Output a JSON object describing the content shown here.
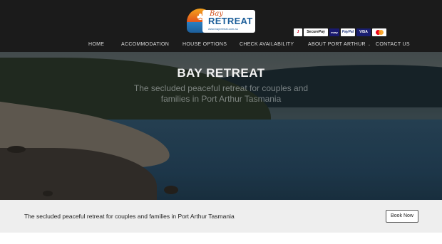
{
  "logo": {
    "small": "Bay",
    "big": "RETREAT",
    "url": "www.bayretreat.com.au",
    "icon": "tree-icon"
  },
  "payments": [
    {
      "label": "J",
      "icon": "payment-j-icon"
    },
    {
      "label": "SecurePay",
      "icon": "securepay-icon"
    },
    {
      "label": "eway",
      "icon": "payment-provider-icon"
    },
    {
      "label": "PayPal",
      "icon": "paypal-icon"
    },
    {
      "label": "VISA",
      "icon": "visa-icon"
    },
    {
      "label": "",
      "icon": "mastercard-icon"
    }
  ],
  "nav": {
    "items": [
      {
        "label": "HOME"
      },
      {
        "label": "ACCOMMODATION"
      },
      {
        "label": "HOUSE OPTIONS"
      },
      {
        "label": "CHECK AVAILABILITY"
      },
      {
        "label": "ABOUT PORT ARTHUR",
        "dropdown": true,
        "chevron": "⌄"
      },
      {
        "label": "CONTACT US"
      }
    ]
  },
  "hero": {
    "title": "BAY RETREAT",
    "subtitle": "The secluded peaceful retreat for couples and families in Port Arthur Tasmania"
  },
  "cta": {
    "text": "The secluded peaceful retreat for couples and families in Port Arthur Tasmania",
    "button_label": "Book Now"
  },
  "colors": {
    "topbar": "#1b1b1b",
    "nav_text": "#dddddd",
    "cta_band": "#eeeeee",
    "accent_orange": "#e5561c",
    "accent_blue": "#1d5f9a"
  }
}
